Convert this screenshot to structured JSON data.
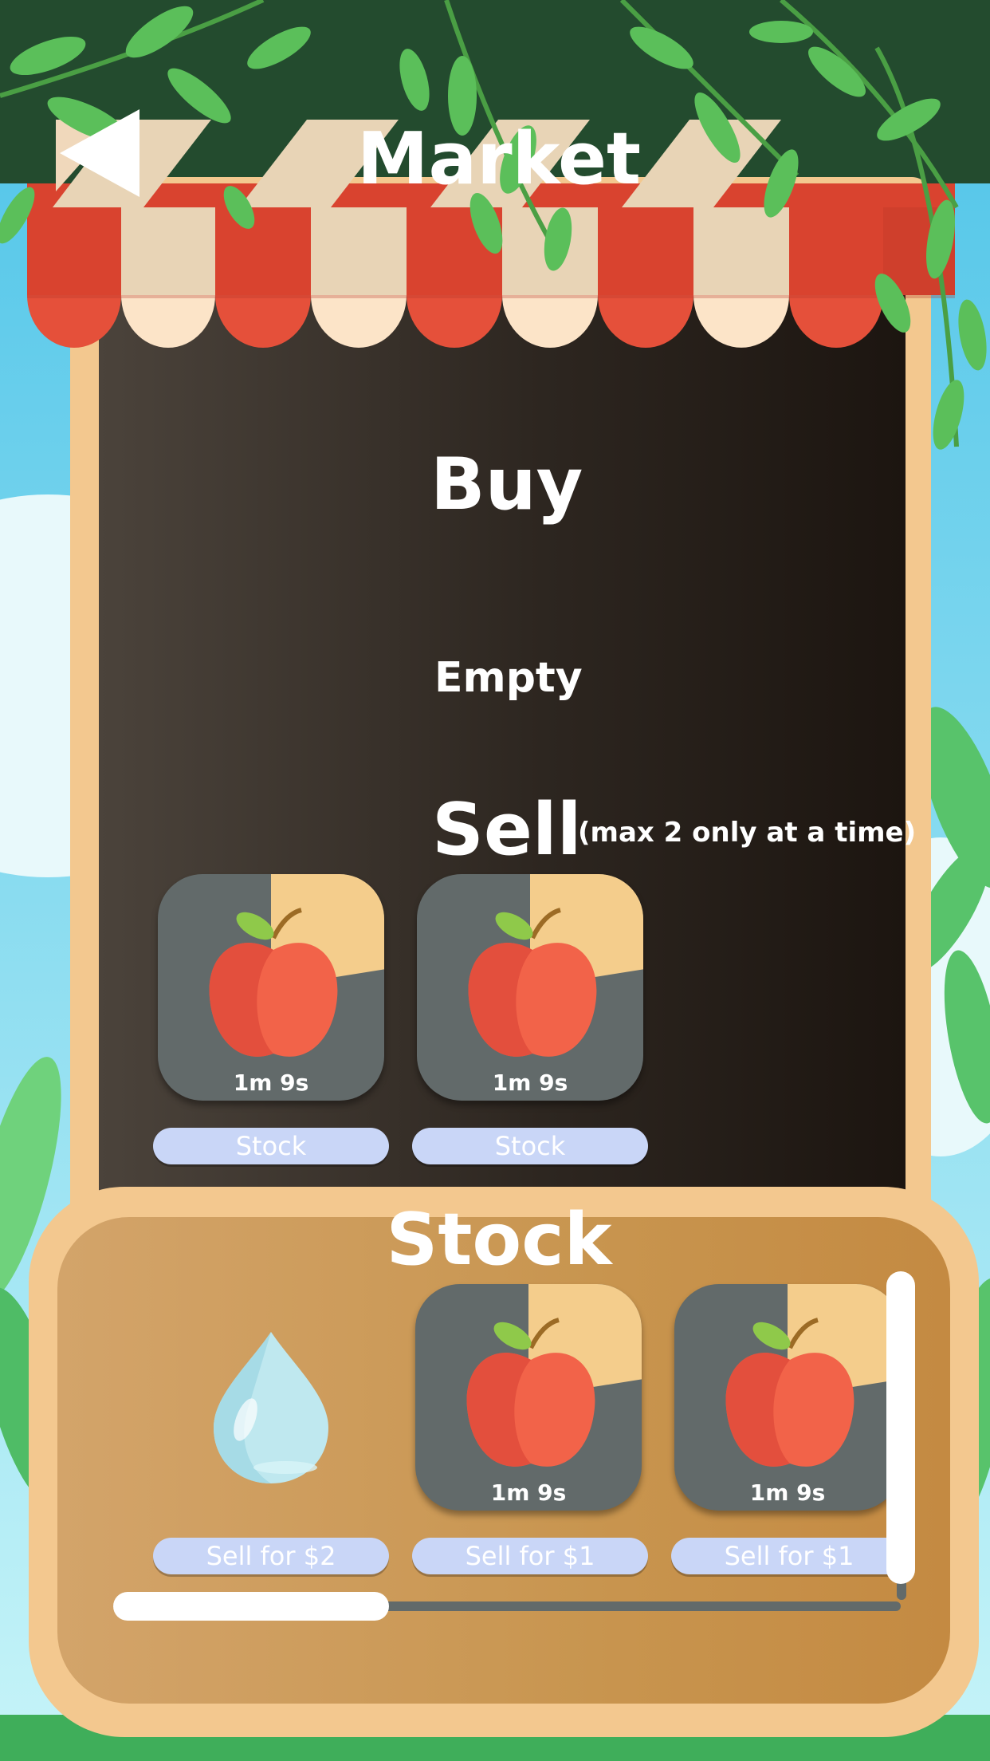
{
  "screen": {
    "title": "Market",
    "back_icon": "back-arrow-icon"
  },
  "buy": {
    "heading": "Buy",
    "empty_text": "Empty"
  },
  "sell": {
    "heading": "Sell",
    "note": "(max 2 only at a time)",
    "items": [
      {
        "icon": "apple-icon",
        "timer": "1m 9s",
        "button_label": "Stock"
      },
      {
        "icon": "apple-icon",
        "timer": "1m 9s",
        "button_label": "Stock"
      }
    ]
  },
  "stock": {
    "heading": "Stock",
    "items": [
      {
        "icon": "water-drop-icon",
        "timer": "",
        "button_label": "Sell for $2"
      },
      {
        "icon": "apple-icon",
        "timer": "1m 9s",
        "button_label": "Sell for $1"
      },
      {
        "icon": "apple-icon",
        "timer": "1m 9s",
        "button_label": "Sell for $1"
      }
    ]
  },
  "colors": {
    "awning_red": "#d9432f",
    "awning_cream": "#f2dcc0",
    "board": "#2a221c",
    "frame": "#f3c88f",
    "stock_panel": "#c8954f",
    "button": "#c9d6f7",
    "tile": "#626a6a",
    "pie": "#f4cd8c"
  }
}
